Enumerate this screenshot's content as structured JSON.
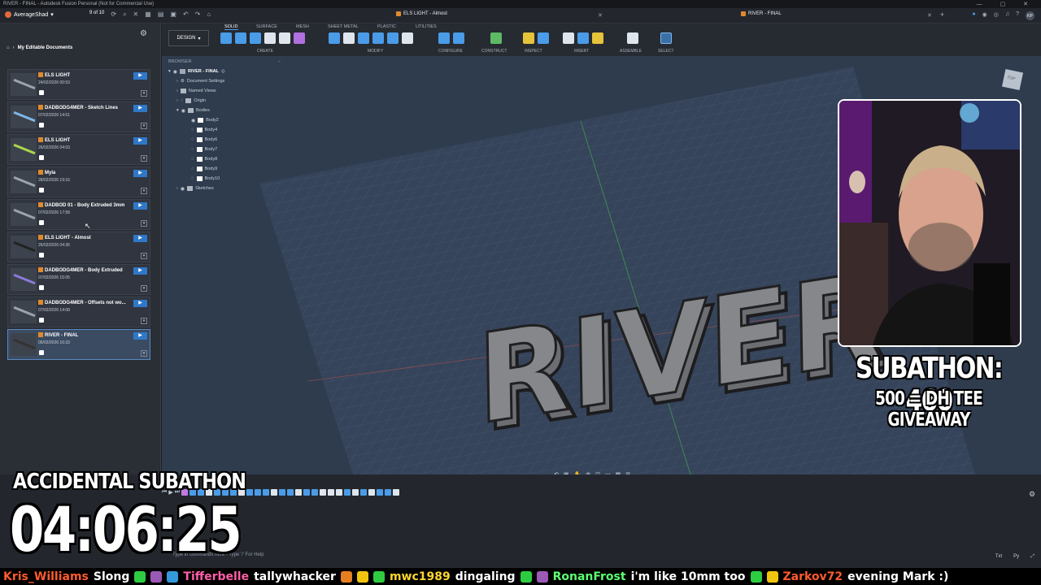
{
  "titlebar": {
    "text": "RIVER - FINAL - Autodesk Fusion Personal (Not for Commercial Use)"
  },
  "topbar": {
    "user": "AverageShad",
    "doc_count": "9 of 10",
    "tab1": "ELS LIGHT - Almost",
    "tab2": "RIVER - FINAL",
    "user_initials": "KP"
  },
  "sidebar": {
    "breadcrumb": "My Editable Documents",
    "docs": [
      {
        "name": "ELS LIGHT",
        "date": "24/02/2026 00:53"
      },
      {
        "name": "DADBODG4MER - Sketch Lines",
        "date": "07/02/2026 14:51"
      },
      {
        "name": "ELS LIGHT",
        "date": "26/02/2026 04:03"
      },
      {
        "name": "Myla",
        "date": "28/02/2026 19:16"
      },
      {
        "name": "DADBOD 01 - Body Extruded 3mm",
        "date": "07/02/2026 17:58"
      },
      {
        "name": "ELS LIGHT - Almost",
        "date": "26/02/2026 04:36"
      },
      {
        "name": "DADBODG4MER - Body Extruded",
        "date": "07/02/2026 15:05"
      },
      {
        "name": "DADBODG4MER - Offsets not wo...",
        "date": "07/02/2026 14:08"
      },
      {
        "name": "RIVER - FINAL",
        "date": "06/02/2026 16:33"
      }
    ]
  },
  "toolbar": {
    "design": "DESIGN",
    "tabs": [
      "SOLID",
      "SURFACE",
      "MESH",
      "SHEET METAL",
      "PLASTIC",
      "UTILITIES"
    ],
    "groups": [
      "CREATE",
      "MODIFY",
      "CONFIGURE",
      "CONSTRUCT",
      "INSPECT",
      "INSERT",
      "ASSEMBLE",
      "SELECT"
    ]
  },
  "browser": {
    "title": "BROWSER",
    "root": "RIVER - FINAL",
    "items": [
      "Document Settings",
      "Named Views",
      "Origin",
      "Bodies"
    ],
    "bodies": [
      "Body2",
      "Body4",
      "Body6",
      "Body7",
      "Body8",
      "Body9",
      "Body10"
    ],
    "sketches": "Sketches"
  },
  "viewport": {
    "model_text": "RIVER",
    "viewcube": "TOP"
  },
  "commandline": {
    "hint": "Type in commands here - Type '/' For Help"
  },
  "overlay": {
    "subathon": "SUBATHON: 460",
    "giveaway": "500 = DH TEE GIVEAWAY",
    "accidental": "ACCIDENTAL SUBATHON",
    "timer": "04:06:25"
  },
  "ticker": [
    {
      "name": "Kris_Williams",
      "msg": "Slong"
    },
    {
      "name": "Tifferbelle",
      "msg": "tallywhacker"
    },
    {
      "name": "mwc1989",
      "msg": "dingaling"
    },
    {
      "name": "RonanFrost",
      "msg": "i'm like 10mm too"
    },
    {
      "name": "Zarkov72",
      "msg": "evening Mark :)"
    }
  ],
  "colors": {
    "accent": "#4a9be8",
    "doc_icon": "#e08a2e",
    "selected_doc": "#3b4b61"
  }
}
